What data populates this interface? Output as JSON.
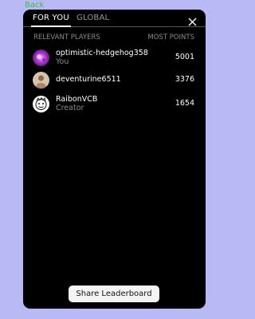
{
  "nav": {
    "back_label": "Back"
  },
  "tabs": [
    {
      "label": "FOR YOU",
      "active": true
    },
    {
      "label": "GLOBAL",
      "active": false
    }
  ],
  "icons": {
    "close": "close-icon"
  },
  "columns": {
    "left": "RELEVANT PLAYERS",
    "right": "MOST POINTS"
  },
  "players": [
    {
      "name": "optimistic-hedgehog358",
      "subtitle": "You",
      "points": "5001",
      "avatar": "purple-galaxy-avatar"
    },
    {
      "name": "deventurine6511",
      "subtitle": "",
      "points": "3376",
      "avatar": "beige-person-avatar"
    },
    {
      "name": "RaibonVCB",
      "subtitle": "Creator",
      "points": "1654",
      "avatar": "cartoon-face-avatar"
    }
  ],
  "share_button": {
    "label": "Share Leaderboard"
  },
  "colors": {
    "background": "#b9b9f5",
    "panel": "#000000",
    "back_link": "#3fbf3f",
    "button_bg": "#f4f4f4"
  }
}
